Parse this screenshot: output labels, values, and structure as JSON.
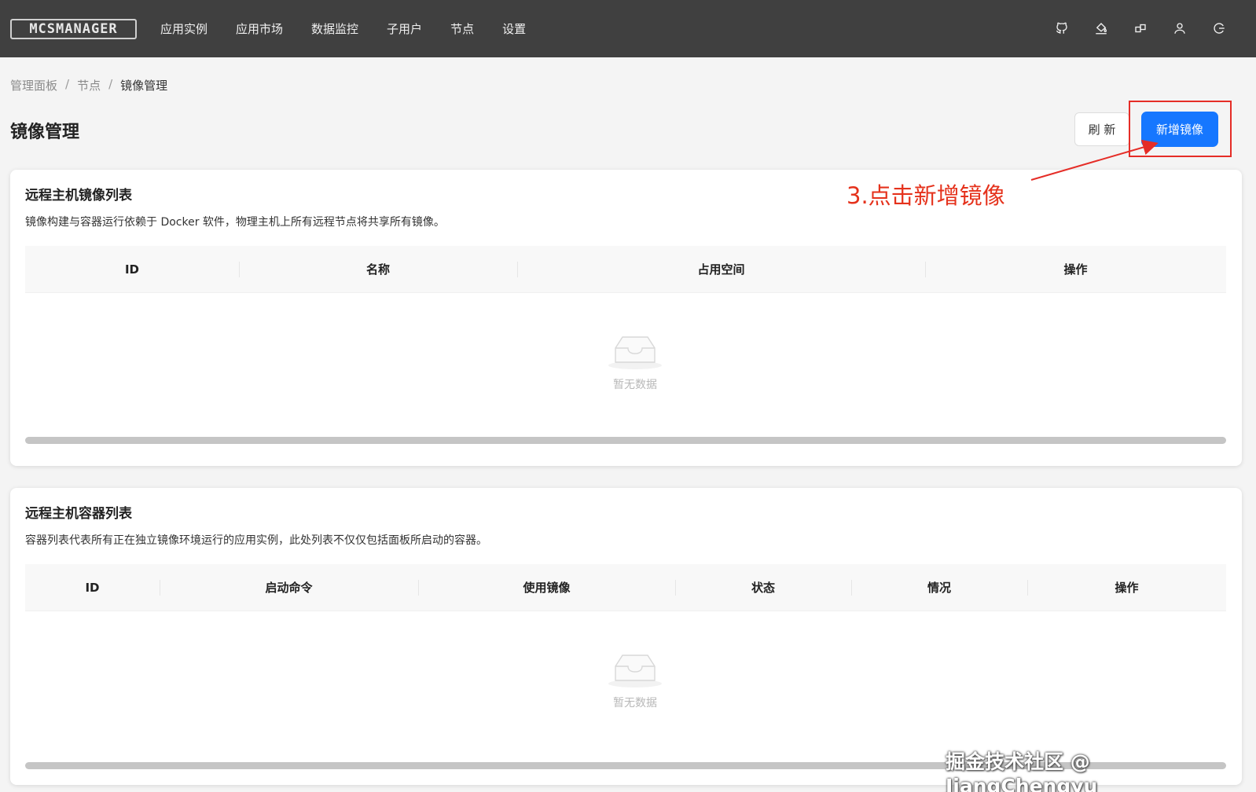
{
  "header": {
    "logo": "MCSMANAGER",
    "nav": [
      "应用实例",
      "应用市场",
      "数据监控",
      "子用户",
      "节点",
      "设置"
    ],
    "icons": [
      "github-icon",
      "paint-bucket-icon",
      "layout-icon",
      "user-icon",
      "logout-icon"
    ]
  },
  "breadcrumb": [
    "管理面板",
    "节点",
    "镜像管理"
  ],
  "breadcrumb_sep": "/",
  "page_title": "镜像管理",
  "toolbar": {
    "refresh_label": "刷 新",
    "add_label": "新增镜像"
  },
  "annotation": "3.点击新增镜像",
  "images_card": {
    "title": "远程主机镜像列表",
    "description": "镜像构建与容器运行依赖于 Docker 软件，物理主机上所有远程节点将共享所有镜像。",
    "columns": [
      "ID",
      "名称",
      "占用空间",
      "操作"
    ],
    "empty_text": "暂无数据"
  },
  "containers_card": {
    "title": "远程主机容器列表",
    "description": "容器列表代表所有正在独立镜像环境运行的应用实例，此处列表不仅仅包括面板所启动的容器。",
    "columns": [
      "ID",
      "启动命令",
      "使用镜像",
      "状态",
      "情况",
      "操作"
    ],
    "empty_text": "暂无数据"
  },
  "watermark": "掘金技术社区 @ JiangChengyu_",
  "colors": {
    "topbar": "#404040",
    "primary": "#1677ff",
    "annotation": "#e5321c"
  }
}
